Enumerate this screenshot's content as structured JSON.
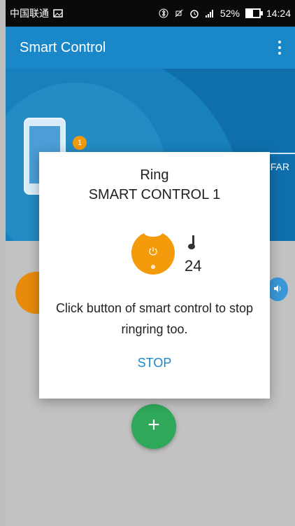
{
  "status_bar": {
    "carrier": "中国联通",
    "battery_percent": "52%",
    "time": "14:24",
    "icons": [
      "image-icon",
      "bluetooth-icon",
      "silent-icon",
      "alarm-icon",
      "signal-icon",
      "battery-icon"
    ]
  },
  "app_bar": {
    "title": "Smart Control",
    "menu_icon": "overflow-menu-icon"
  },
  "panel": {
    "pin_badge": "1",
    "far_label": "FAR"
  },
  "dialog": {
    "title": "Ring",
    "subtitle": "SMART CONTROL 1",
    "ring_count": "24",
    "message": "Click button of smart control to stop ringring too.",
    "stop_label": "STOP"
  },
  "fab": {
    "label": "+"
  },
  "colors": {
    "app_bar": "#1a87c9",
    "panel": "#0f6fad",
    "orange": "#f49b0b",
    "fab_green": "#2fa85a",
    "link_blue": "#1a87c9"
  }
}
